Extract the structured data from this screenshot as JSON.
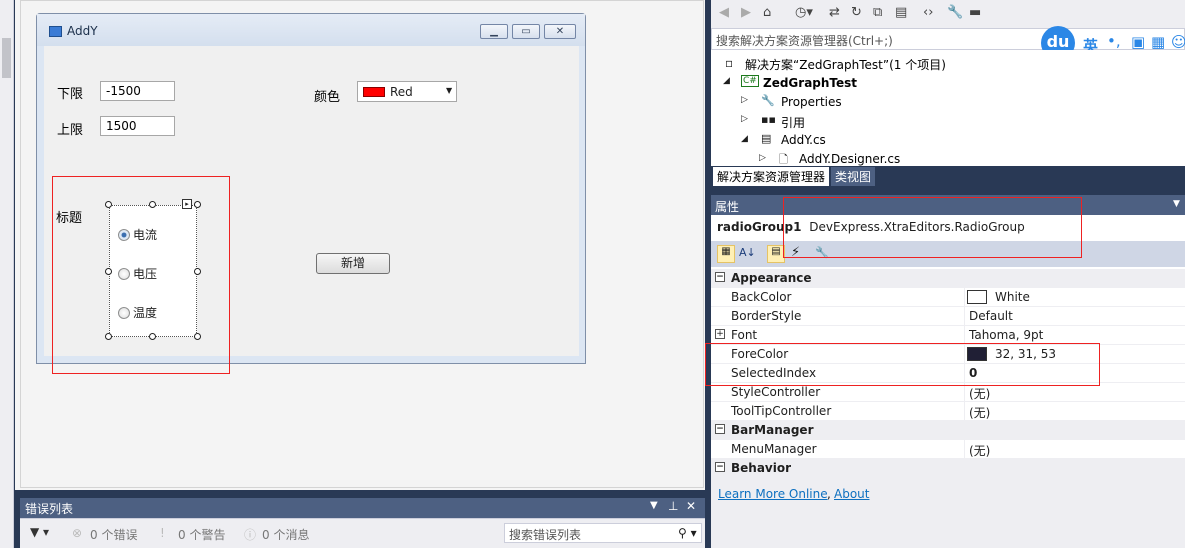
{
  "form": {
    "title": "AddY",
    "lower_label": "下限",
    "lower_value": "-1500",
    "upper_label": "上限",
    "upper_value": "1500",
    "color_label": "颜色",
    "color_value": "Red",
    "title_label": "标题",
    "radio_items": [
      "电流",
      "电压",
      "温度"
    ],
    "add_button": "新增"
  },
  "error_list": {
    "title": "错误列表",
    "errors": "0 个错误",
    "warnings": "0 个警告",
    "messages": "0 个消息",
    "search_placeholder": "搜索错误列表"
  },
  "solution": {
    "search_placeholder": "搜索解决方案资源管理器(Ctrl+;)",
    "solution_line": "解决方案“ZedGraphTest”(1 个项目)",
    "project": "ZedGraphTest",
    "items": [
      "Properties",
      "引用",
      "AddY.cs",
      "AddY.Designer.cs"
    ],
    "tab_explorer": "解决方案资源管理器",
    "tab_classview": "类视图",
    "ime_text": "英"
  },
  "properties": {
    "header": "属性",
    "object_name": "radioGroup1",
    "object_type": "DevExpress.XtraEditors.RadioGroup",
    "categories": {
      "appearance": "Appearance",
      "barmanager": "BarManager",
      "behavior": "Behavior"
    },
    "rows": {
      "backcolor_name": "BackColor",
      "backcolor_value": "White",
      "borderstyle_name": "BorderStyle",
      "borderstyle_value": "Default",
      "font_name": "Font",
      "font_value": "Tahoma, 9pt",
      "forecolor_name": "ForeColor",
      "forecolor_value": "32, 31, 53",
      "selectedindex_name": "SelectedIndex",
      "selectedindex_value": "0",
      "stylecontroller_name": "StyleController",
      "stylecontroller_value": "(无)",
      "tooltip_name": "ToolTipController",
      "tooltip_value": "(无)",
      "menumanager_name": "MenuManager",
      "menumanager_value": "(无)"
    },
    "learn_more": "Learn More Online",
    "about": "About"
  },
  "colors": {
    "red_swatch": "#ff0000",
    "forecolor_swatch": "#201f35",
    "header_blue": "#4d6082"
  }
}
